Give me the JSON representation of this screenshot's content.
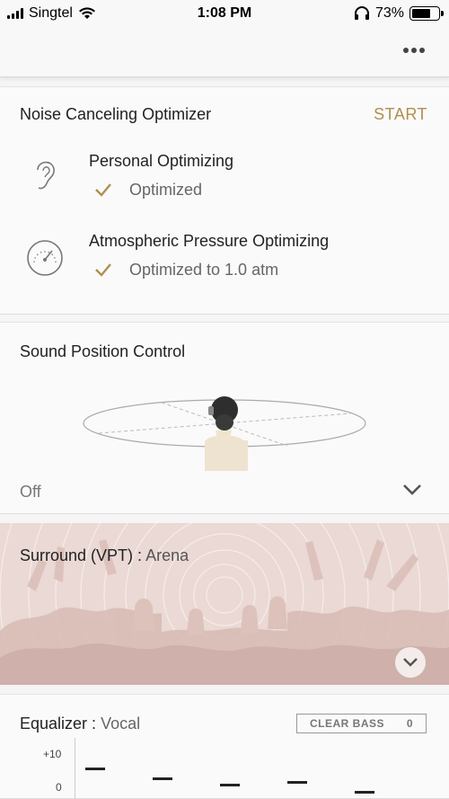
{
  "status_bar": {
    "carrier": "Singtel",
    "time": "1:08 PM",
    "battery_percent_text": "73%",
    "battery_level": 0.73
  },
  "noise_canceling_optimizer": {
    "title": "Noise Canceling Optimizer",
    "start_label": "START",
    "accent_color": "#b08f4f",
    "items": [
      {
        "icon": "ear-icon",
        "title": "Personal Optimizing",
        "status": "Optimized"
      },
      {
        "icon": "pressure-gauge-icon",
        "title": "Atmospheric Pressure Optimizing",
        "status": "Optimized to 1.0 atm"
      }
    ]
  },
  "sound_position_control": {
    "title": "Sound Position Control",
    "value": "Off"
  },
  "surround": {
    "label": "Surround (VPT)",
    "separator": " : ",
    "value": "Arena"
  },
  "equalizer": {
    "label": "Equalizer",
    "separator": " : ",
    "value": "Vocal",
    "clear_bass_label": "CLEAR BASS",
    "clear_bass_value": "0",
    "axis_top": "+10",
    "axis_mid": "0",
    "bands": [
      6,
      3,
      1,
      2,
      -1
    ]
  }
}
